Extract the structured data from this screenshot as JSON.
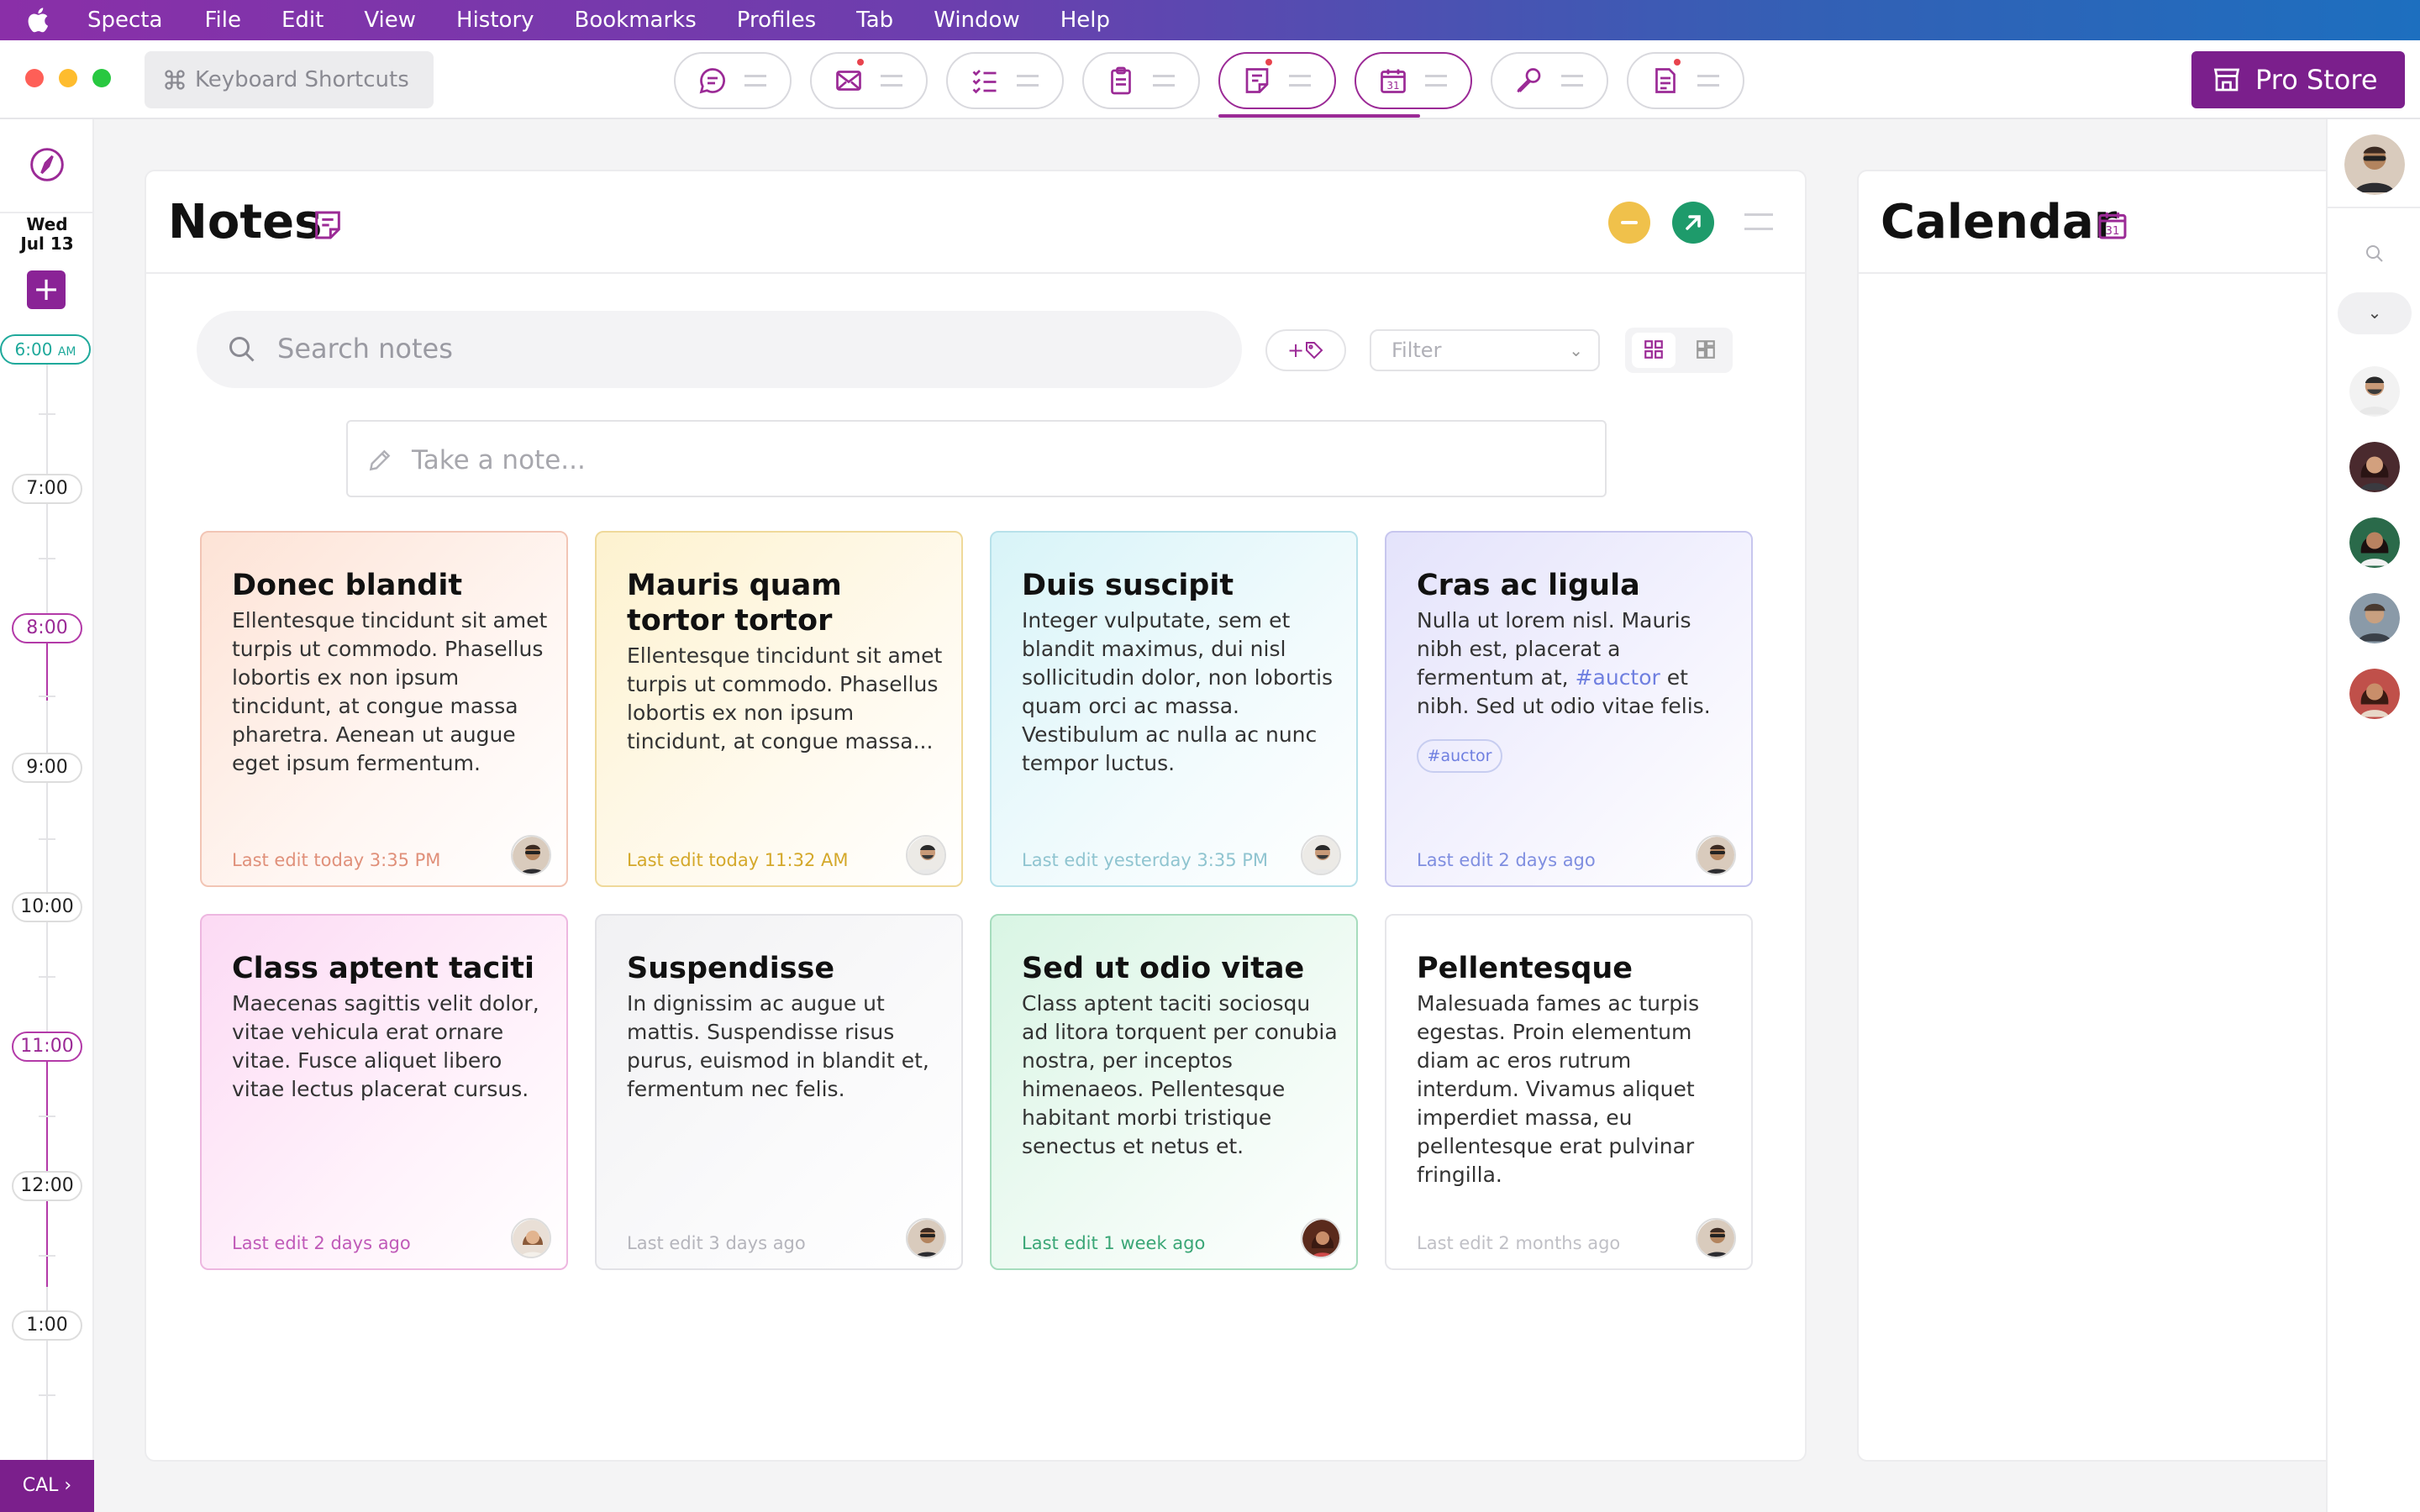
{
  "menubar": {
    "app_name": "Specta",
    "items": [
      "File",
      "Edit",
      "View",
      "History",
      "Bookmarks",
      "Profiles",
      "Tab",
      "Window",
      "Help"
    ]
  },
  "toolbar": {
    "shortcuts_label": "Keyboard Shortcuts",
    "tabs": [
      {
        "icon": "chat-icon",
        "badge": false,
        "active": false
      },
      {
        "icon": "mail-icon",
        "badge": true,
        "active": false
      },
      {
        "icon": "checklist-icon",
        "badge": false,
        "active": false
      },
      {
        "icon": "clipboard-icon",
        "badge": false,
        "active": false
      },
      {
        "icon": "notes-icon",
        "badge": true,
        "active": true
      },
      {
        "icon": "calendar-icon",
        "badge": false,
        "active": true
      },
      {
        "icon": "microphone-icon",
        "badge": false,
        "active": false
      },
      {
        "icon": "document-icon",
        "badge": true,
        "active": false
      }
    ],
    "calendar_icon_day": "31",
    "pro_store_label": "Pro Store"
  },
  "left_rail": {
    "weekday": "Wed",
    "date": "Jul 13",
    "add_label": "+",
    "now_time": "6:00",
    "now_suffix": "AM",
    "times": [
      "7:00",
      "8:00",
      "9:00",
      "10:00",
      "11:00",
      "12:00",
      "1:00"
    ],
    "cal_label": "CAL ›"
  },
  "notes_panel": {
    "title": "Notes",
    "search_placeholder": "Search notes",
    "tag_button_label": "+",
    "filter_placeholder": "Filter",
    "take_note_placeholder": "Take a note...",
    "cards": [
      {
        "title": "Donec blandit",
        "body": "Ellentesque tincidunt sit amet turpis ut commodo. Phasellus lobortis ex non ipsum tincidunt, at congue massa pharetra. Aenean ut augue eget ipsum fermentum.",
        "footer": "Last edit today 3:35 PM",
        "theme": "peach",
        "footer_color": "#e0907a"
      },
      {
        "title": "Mauris quam tortor tortor",
        "body": "Ellentesque tincidunt sit amet turpis ut commodo. Phasellus lobortis ex non ipsum tincidunt, at congue massa...",
        "footer": "Last edit today 11:32 AM",
        "theme": "yellow",
        "footer_color": "#d4a82a"
      },
      {
        "title": "Duis suscipit",
        "body": "Integer vulputate, sem et blandit maximus, dui nisl sollicitudin dolor, non lobortis quam orci ac massa. Vestibulum ac nulla ac nunc tempor luctus.",
        "footer": "Last edit yesterday 3:35 PM",
        "theme": "cyan",
        "footer_color": "#8fc4d0"
      },
      {
        "title": "Cras ac ligula",
        "body_before": "Nulla ut lorem nisl. Mauris nibh est, placerat a fermentum at,",
        "body_tag": "#auctor",
        "body_after": "et nibh. Sed ut odio vitae felis.",
        "chip": "#auctor",
        "footer": "Last edit 2 days ago",
        "theme": "lavender",
        "footer_color": "#7f8ee0"
      },
      {
        "title": "Class aptent taciti",
        "body": "Maecenas sagittis velit dolor, vitae vehicula erat ornare vitae. Fusce aliquet libero vitae lectus placerat cursus.",
        "footer": "Last edit 2 days ago",
        "theme": "pink",
        "footer_color": "#c05ab8"
      },
      {
        "title": "Suspendisse",
        "body": "In dignissim ac augue ut mattis. Suspendisse risus purus, euismod in blandit et, fermentum nec felis.",
        "footer": "Last edit 3 days ago",
        "theme": "gray",
        "footer_color": "#b5b5bc"
      },
      {
        "title": "Sed ut odio vitae",
        "body": "Class aptent taciti sociosqu ad litora torquent per conubia nostra, per inceptos himenaeos. Pellentesque habitant morbi tristique senectus et netus et.",
        "footer": "Last edit 1 week ago",
        "theme": "green",
        "footer_color": "#3aa676"
      },
      {
        "title": "Pellentesque",
        "body": "Malesuada fames ac turpis egestas. Proin elementum diam ac eros rutrum interdum. Vivamus aliquet imperdiet massa, eu pellentesque erat pulvinar fringilla.",
        "footer": "Last edit 2 months ago",
        "theme": "white",
        "footer_color": "#c0c0c6"
      }
    ]
  },
  "calendar_panel": {
    "title": "Calendar"
  },
  "colors": {
    "accent": "#7b1f8c",
    "now_indicator": "#1fa99b"
  }
}
